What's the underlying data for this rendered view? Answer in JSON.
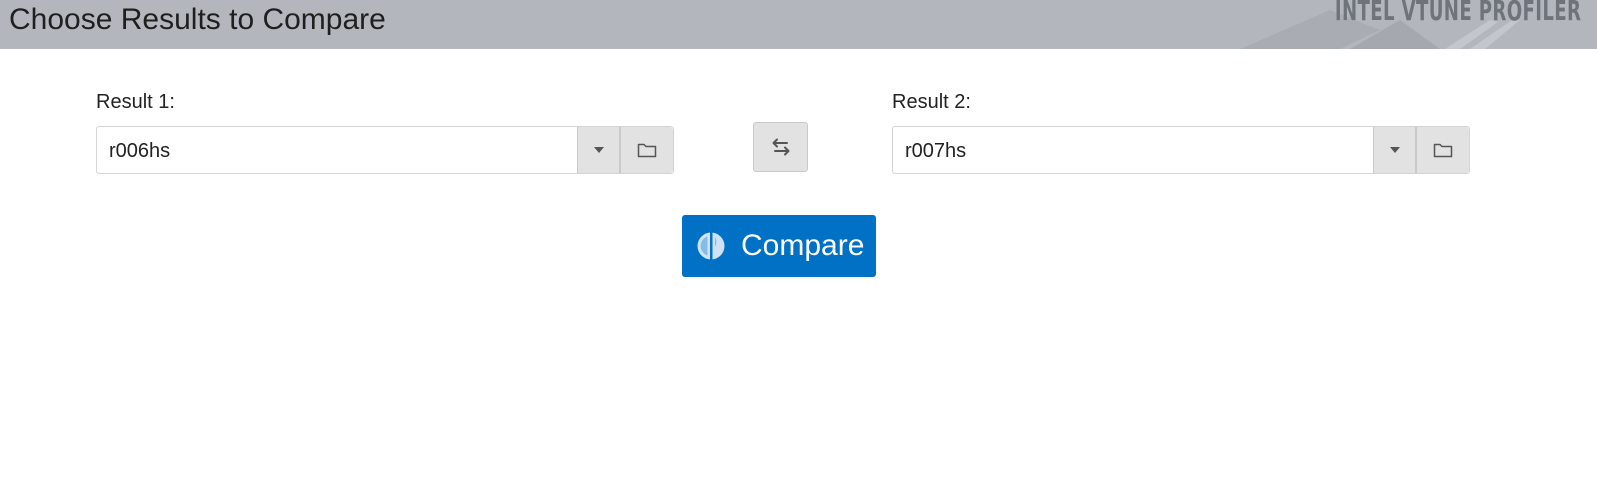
{
  "header": {
    "title": "Choose Results to Compare",
    "brand": "INTEL VTUNE PROFILER"
  },
  "result1": {
    "label": "Result 1:",
    "value": "r006hs"
  },
  "result2": {
    "label": "Result 2:",
    "value": "r007hs"
  },
  "compare_button": {
    "label": "Compare"
  },
  "colors": {
    "header_bg": "#b3b7bd",
    "accent": "#0071c5",
    "button_gray": "#e2e2e2"
  },
  "icons": {
    "dropdown": "chevron-down-icon",
    "browse": "folder-icon",
    "swap": "swap-arrows-icon",
    "compare": "compare-icon"
  }
}
